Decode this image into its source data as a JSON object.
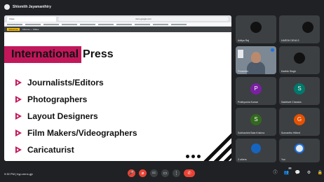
{
  "top": {
    "title": "Shlomith Jayamanthiry"
  },
  "browser": {
    "tab_label": "Class",
    "url": "docs.google.com",
    "slide_chip": "Slideshow",
    "slide_chip2": "Chrome — Slides"
  },
  "slide": {
    "title_highlight": "International",
    "title_rest": "Press",
    "bullets": [
      "Journalists/Editors",
      "Photographers",
      "Layout Designers",
      "Film Makers/Videographers",
      "Caricaturist"
    ]
  },
  "participants": [
    {
      "name": "Aditya Raj",
      "initial": "",
      "color": "#111111"
    },
    {
      "name": "HARSH DEVA S",
      "initial": "",
      "color": "#111111"
    },
    {
      "name": "Presenter",
      "initial": "",
      "color": ""
    },
    {
      "name": "Karthik Singh",
      "initial": "",
      "color": "#111111"
    },
    {
      "name": "Prathyusha Kumar",
      "initial": "P",
      "color": "#7b1fa2"
    },
    {
      "name": "Sakthivel Chandra",
      "initial": "S",
      "color": "#00796b"
    },
    {
      "name": "Subhashini Bala Krishna",
      "initial": "S",
      "color": "#33691e"
    },
    {
      "name": "Sumanthu Hilbert",
      "initial": "G",
      "color": "#e65100"
    },
    {
      "name": "3 others",
      "initial": "",
      "color": "#1565c0"
    },
    {
      "name": "You",
      "initial": "",
      "color": "#e8eaed"
    }
  ],
  "bottom": {
    "meeting_info": "9:30 PM | hyp-eenx-gjv",
    "controls": {
      "mic": "🎤",
      "cam": "⌀",
      "captions": "CC",
      "present": "▭",
      "more": "⋮",
      "end": "✆"
    },
    "right": {
      "info": "ⓘ",
      "people": "👥",
      "people_count": "12",
      "chat": "💬",
      "activities": "⚙",
      "shield": "🔒"
    }
  },
  "colors": {
    "accent": "#c2185b",
    "background": "#202124",
    "tile": "#3c4043"
  }
}
